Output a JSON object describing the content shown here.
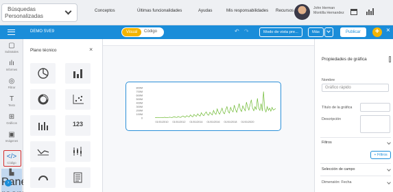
{
  "topbar": {
    "search_line1": "Búsquedas",
    "search_line2": "Personalizadas",
    "menu": [
      "Conceptos",
      "Últimas funcionalidades",
      "Ayudas",
      "Mis responsabilidades",
      "Recursos"
    ],
    "user_line1": "John Herman",
    "user_line2": "Montilla Hernandez"
  },
  "bluebar": {
    "title": "DEMO SVE9",
    "toggle_visual": "Visual",
    "toggle_code": "Código",
    "preview_mode": "Modo de vista pre...",
    "more": "Más",
    "publish": "Publicar"
  },
  "rail": {
    "items": [
      {
        "label": "Subtotales",
        "icon": "table-icon"
      },
      {
        "label": "Informes",
        "icon": "bar-chart-icon"
      },
      {
        "label": "Filtrar",
        "icon": "filter-icon"
      },
      {
        "label": "Texto",
        "icon": "text-icon"
      },
      {
        "label": "Gráficos",
        "icon": "charts-icon"
      },
      {
        "label": "Imágenes",
        "icon": "image-icon"
      },
      {
        "label": "Código",
        "icon": "code-icon"
      },
      {
        "label": "Pane rasmos",
        "icon": "panel-icon"
      }
    ]
  },
  "panel": {
    "title": "Plano técnico",
    "tiles": [
      "pie-chart-icon",
      "bar-chart-icon",
      "donut-chart-icon",
      "scatter-chart-icon",
      "column-chart-icon",
      "123",
      "line-chart-icon",
      "boxplot-chart-icon",
      "gauge-chart-icon",
      "table-chart-icon"
    ]
  },
  "chart_data": {
    "type": "line",
    "y_ticks": [
      "800M",
      "700M",
      "600M",
      "500M",
      "400M",
      "300M",
      "200M",
      "100M",
      "0"
    ],
    "x_ticks": [
      "01/01/2010",
      "01/01/2012",
      "01/01/2014",
      "01/01/2016",
      "01/01/2018",
      "01/01/2020"
    ],
    "ylim": [
      0,
      800
    ],
    "color": "#6bb82e",
    "series_values_millions": [
      12,
      8,
      15,
      10,
      6,
      14,
      9,
      11,
      18,
      10,
      7,
      12,
      20,
      15,
      9,
      25,
      30,
      18,
      12,
      40,
      22,
      15,
      35,
      55,
      28,
      18,
      60,
      42,
      25,
      80,
      50,
      30,
      95,
      60,
      45,
      110,
      70,
      50,
      140,
      85,
      60,
      120,
      160,
      90,
      70,
      150,
      110,
      80,
      200,
      130,
      95,
      240,
      150,
      100,
      180,
      260,
      140,
      110,
      220,
      300,
      170,
      130,
      280,
      200,
      160,
      340,
      230,
      150,
      260,
      380,
      220,
      170,
      320,
      250,
      190,
      420,
      290,
      210,
      360,
      480,
      260,
      190,
      300,
      220,
      520,
      260,
      200,
      380,
      180,
      700,
      240,
      160,
      300,
      200,
      260,
      180,
      280,
      210,
      230,
      250
    ]
  },
  "props": {
    "title": "Propiedades de gráfica",
    "name_label": "Nombre",
    "name_value": "Gráfico rápido",
    "chart_title_label": "Título de la gráfica",
    "description_label": "Descripción",
    "filters_label": "Filtros",
    "add_filter": "+ Filtros",
    "field_selection": "Selección de campo",
    "dimension": "Dimensión: Fecha"
  }
}
